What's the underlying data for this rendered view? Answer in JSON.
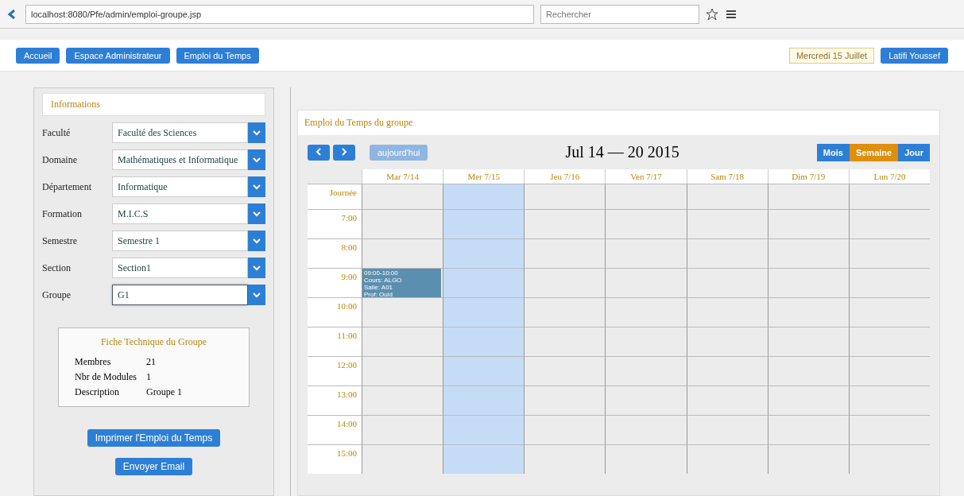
{
  "browser": {
    "address": "localhost:8080/Pfe/admin/emploi-groupe.jsp",
    "search_placeholder": "Rechercher"
  },
  "nav": {
    "left_buttons": [
      "Accueil",
      "Espace Administrateur",
      "Emploi du Temps"
    ],
    "date": "Mercredi 15 Juillet",
    "user_button": "Latifi Youssef"
  },
  "form": {
    "title": "Informations",
    "fields": [
      {
        "label": "Faculté",
        "value": "Faculté des Sciences",
        "focused": false
      },
      {
        "label": "Domaine",
        "value": "Mathématiques et Informatique",
        "focused": false
      },
      {
        "label": "Département",
        "value": "Informatique",
        "focused": false
      },
      {
        "label": "Formation",
        "value": "M.I.C.S",
        "focused": false
      },
      {
        "label": "Semestre",
        "value": "Semestre 1",
        "focused": false
      },
      {
        "label": "Section",
        "value": "Section1",
        "focused": false
      },
      {
        "label": "Groupe",
        "value": "G1",
        "focused": true
      }
    ]
  },
  "group_sheet": {
    "title": "Fiche Technique du Groupe",
    "rows": [
      {
        "label": "Membres",
        "value": "21"
      },
      {
        "label": "Nbr de Modules",
        "value": "1"
      },
      {
        "label": "Description",
        "value": "Groupe 1"
      }
    ]
  },
  "actions": [
    "Imprimer l'Emploi du Temps",
    "Envoyer Email"
  ],
  "calendar": {
    "title": "Emploi du Temps du groupe",
    "today_button": "aujourd'hui",
    "range": "Jul 14 — 20 2015",
    "views": [
      {
        "label": "Mois",
        "selected": false
      },
      {
        "label": "Semaine",
        "selected": true
      },
      {
        "label": "Jour",
        "selected": false
      }
    ],
    "days": [
      {
        "label": "Mar 7/14",
        "today": false
      },
      {
        "label": "Mer 7/15",
        "today": true
      },
      {
        "label": "Jeu 7/16",
        "today": false
      },
      {
        "label": "Ven 7/17",
        "today": false
      },
      {
        "label": "Sam 7/18",
        "today": false
      },
      {
        "label": "Dim 7/19",
        "today": false
      },
      {
        "label": "Lun 7/20",
        "today": false
      }
    ],
    "all_day_label": "Journée",
    "hours": [
      "7:00",
      "8:00",
      "9:00",
      "10:00",
      "11:00",
      "12:00",
      "13:00",
      "14:00",
      "15:00"
    ],
    "events": [
      {
        "lines": [
          "09:00-10:00",
          "Cours: ALGO",
          "Salle: A01",
          "Prof: Ould"
        ]
      }
    ]
  }
}
